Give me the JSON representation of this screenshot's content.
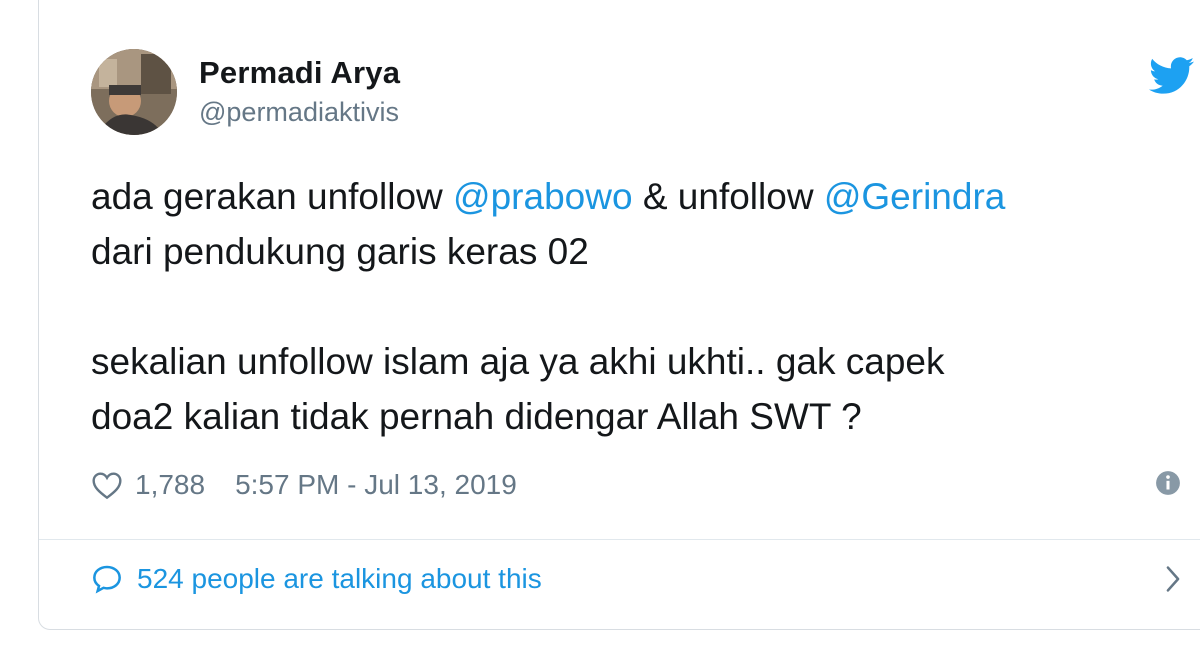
{
  "author": {
    "display_name": "Permadi Arya",
    "handle": "@permadiaktivis",
    "avatar_icon": "profile-photo"
  },
  "tweet": {
    "line1": {
      "a": "ada gerakan unfollow ",
      "mention1": "@prabowo",
      "b": " & unfollow ",
      "mention2": "@Gerindra"
    },
    "line2": "dari pendukung garis keras 02",
    "line3": "sekalian unfollow islam aja ya akhi ukhti.. gak capek",
    "line4": "doa2 kalian tidak pernah didengar Allah SWT ?"
  },
  "meta": {
    "like_count": "1,788",
    "timestamp": "5:57 PM - Jul 13, 2019",
    "like_icon": "heart-outline-icon",
    "info_icon": "info-icon"
  },
  "footer": {
    "talking_label": "524 people are talking about this",
    "bubble_icon": "speech-bubble-icon",
    "chevron_icon": "chevron-right-icon"
  },
  "colors": {
    "text": "#14171a",
    "muted": "#657786",
    "link": "#1b95e0",
    "brand": "#1da1f2",
    "border": "#d8dde2"
  }
}
